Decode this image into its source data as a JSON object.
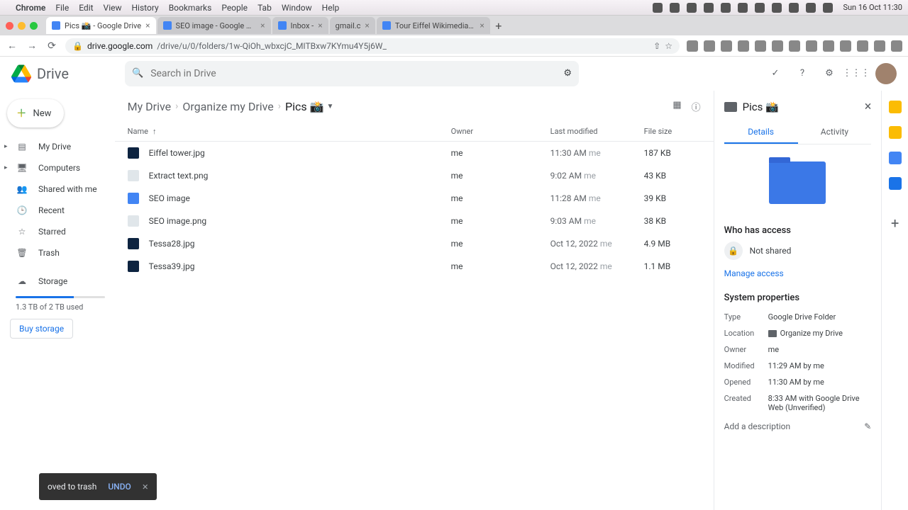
{
  "mac_menu": {
    "app": "Chrome",
    "items": [
      "File",
      "Edit",
      "View",
      "History",
      "Bookmarks",
      "People",
      "Tab",
      "Window",
      "Help"
    ],
    "clock": "Sun 16 Oct 11:30"
  },
  "tabs": [
    {
      "label": "Pics 📸 - Google Drive",
      "active": true
    },
    {
      "label": "SEO image - Google Docs",
      "active": false
    },
    {
      "label": "Inbox -",
      "active": false
    },
    {
      "label": "gmail.c",
      "active": false
    },
    {
      "label": "Tour Eiffel Wikimedia Comm",
      "active": false
    }
  ],
  "url": {
    "host": "drive.google.com",
    "path": "/drive/u/0/folders/1w-QiOh_wbxcjC_MITBxw7KYmu4Y5j6W_"
  },
  "drive": {
    "app_name": "Drive"
  },
  "search": {
    "placeholder": "Search in Drive"
  },
  "new_button": "New",
  "sidebar": {
    "items": [
      {
        "label": "My Drive",
        "icon": "▸"
      },
      {
        "label": "Computers",
        "icon": "▸"
      },
      {
        "label": "Shared with me",
        "icon": ""
      },
      {
        "label": "Recent",
        "icon": ""
      },
      {
        "label": "Starred",
        "icon": ""
      },
      {
        "label": "Trash",
        "icon": ""
      }
    ],
    "storage_label": "Storage",
    "storage_used": "1.3 TB of 2 TB used",
    "buy": "Buy storage"
  },
  "breadcrumb": [
    "My Drive",
    "Organize my Drive",
    "Pics 📸"
  ],
  "columns": {
    "name": "Name",
    "owner": "Owner",
    "modified": "Last modified",
    "size": "File size"
  },
  "files": [
    {
      "name": "Eiffel tower.jpg",
      "owner": "me",
      "mod": "11:30 AM",
      "by": "me",
      "size": "187 KB",
      "kind": "img"
    },
    {
      "name": "Extract text.png",
      "owner": "me",
      "mod": "9:02 AM",
      "by": "me",
      "size": "43 KB",
      "kind": "png"
    },
    {
      "name": "SEO image",
      "owner": "me",
      "mod": "11:28 AM",
      "by": "me",
      "size": "39 KB",
      "kind": "doc"
    },
    {
      "name": "SEO image.png",
      "owner": "me",
      "mod": "9:03 AM",
      "by": "me",
      "size": "38 KB",
      "kind": "png"
    },
    {
      "name": "Tessa28.jpg",
      "owner": "me",
      "mod": "Oct 12, 2022",
      "by": "me",
      "size": "4.9 MB",
      "kind": "img"
    },
    {
      "name": "Tessa39.jpg",
      "owner": "me",
      "mod": "Oct 12, 2022",
      "by": "me",
      "size": "1.1 MB",
      "kind": "img"
    }
  ],
  "details": {
    "title": "Pics 📸",
    "tabs": {
      "details": "Details",
      "activity": "Activity"
    },
    "access_title": "Who has access",
    "not_shared": "Not shared",
    "manage": "Manage access",
    "sys_title": "System properties",
    "props": {
      "Type": "Google Drive Folder",
      "Location": "Organize my Drive",
      "Owner": "me",
      "Modified": "11:29 AM by me",
      "Opened": "11:30 AM by me",
      "Created": "8:33 AM with Google Drive Web (Unverified)"
    },
    "add_desc": "Add a description"
  },
  "toast": {
    "msg": "oved to trash",
    "undo": "UNDO"
  }
}
